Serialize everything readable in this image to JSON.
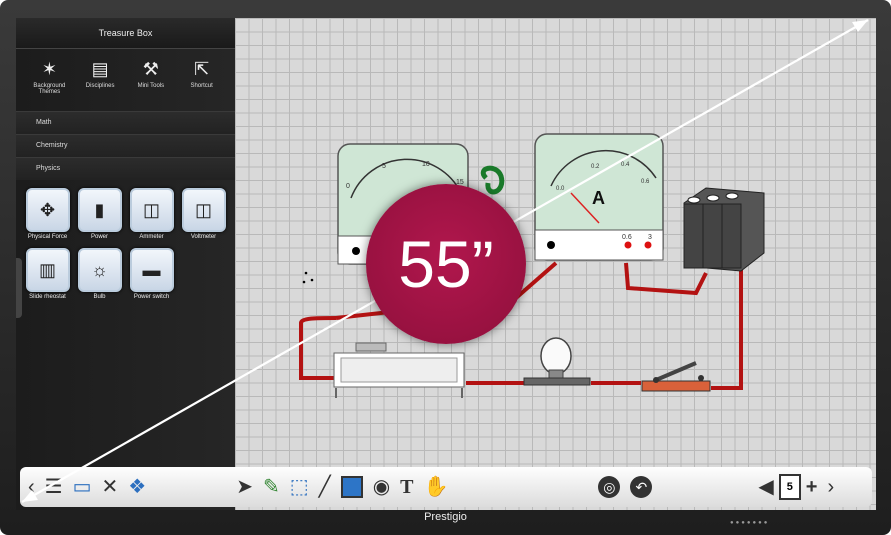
{
  "panel": {
    "title": "Treasure Box",
    "icons": [
      {
        "label": "Background Themes",
        "icon": "magic-wand-icon"
      },
      {
        "label": "Disciplines",
        "icon": "book-icon"
      },
      {
        "label": "Mini Tools",
        "icon": "toolbox-icon"
      },
      {
        "label": "Shortcut",
        "icon": "shortcut-icon"
      }
    ],
    "categories": [
      "Math",
      "Chemistry",
      "Physics"
    ],
    "items": [
      {
        "label": "Physical Force"
      },
      {
        "label": "Power"
      },
      {
        "label": "Ammeter"
      },
      {
        "label": "Voltmeter"
      },
      {
        "label": "Slide rheostat"
      },
      {
        "label": "Bulb"
      },
      {
        "label": "Power switch"
      }
    ]
  },
  "canvas": {
    "voltmeter_scale": [
      "0",
      "5",
      "10",
      "15"
    ],
    "ammeter_letter": "A",
    "ammeter_scale": [
      "0.0",
      "0.2",
      "0.4",
      "0.6"
    ],
    "ammeter_terminals": [
      "0.6",
      "3"
    ]
  },
  "badge": {
    "text": "55”"
  },
  "toolbar": {
    "page_number": "5"
  },
  "brand": {
    "name": "Prestigio"
  },
  "colors": {
    "badge": "#9b1242",
    "wire": "#b31212",
    "meter_face": "#cfe6d5"
  }
}
